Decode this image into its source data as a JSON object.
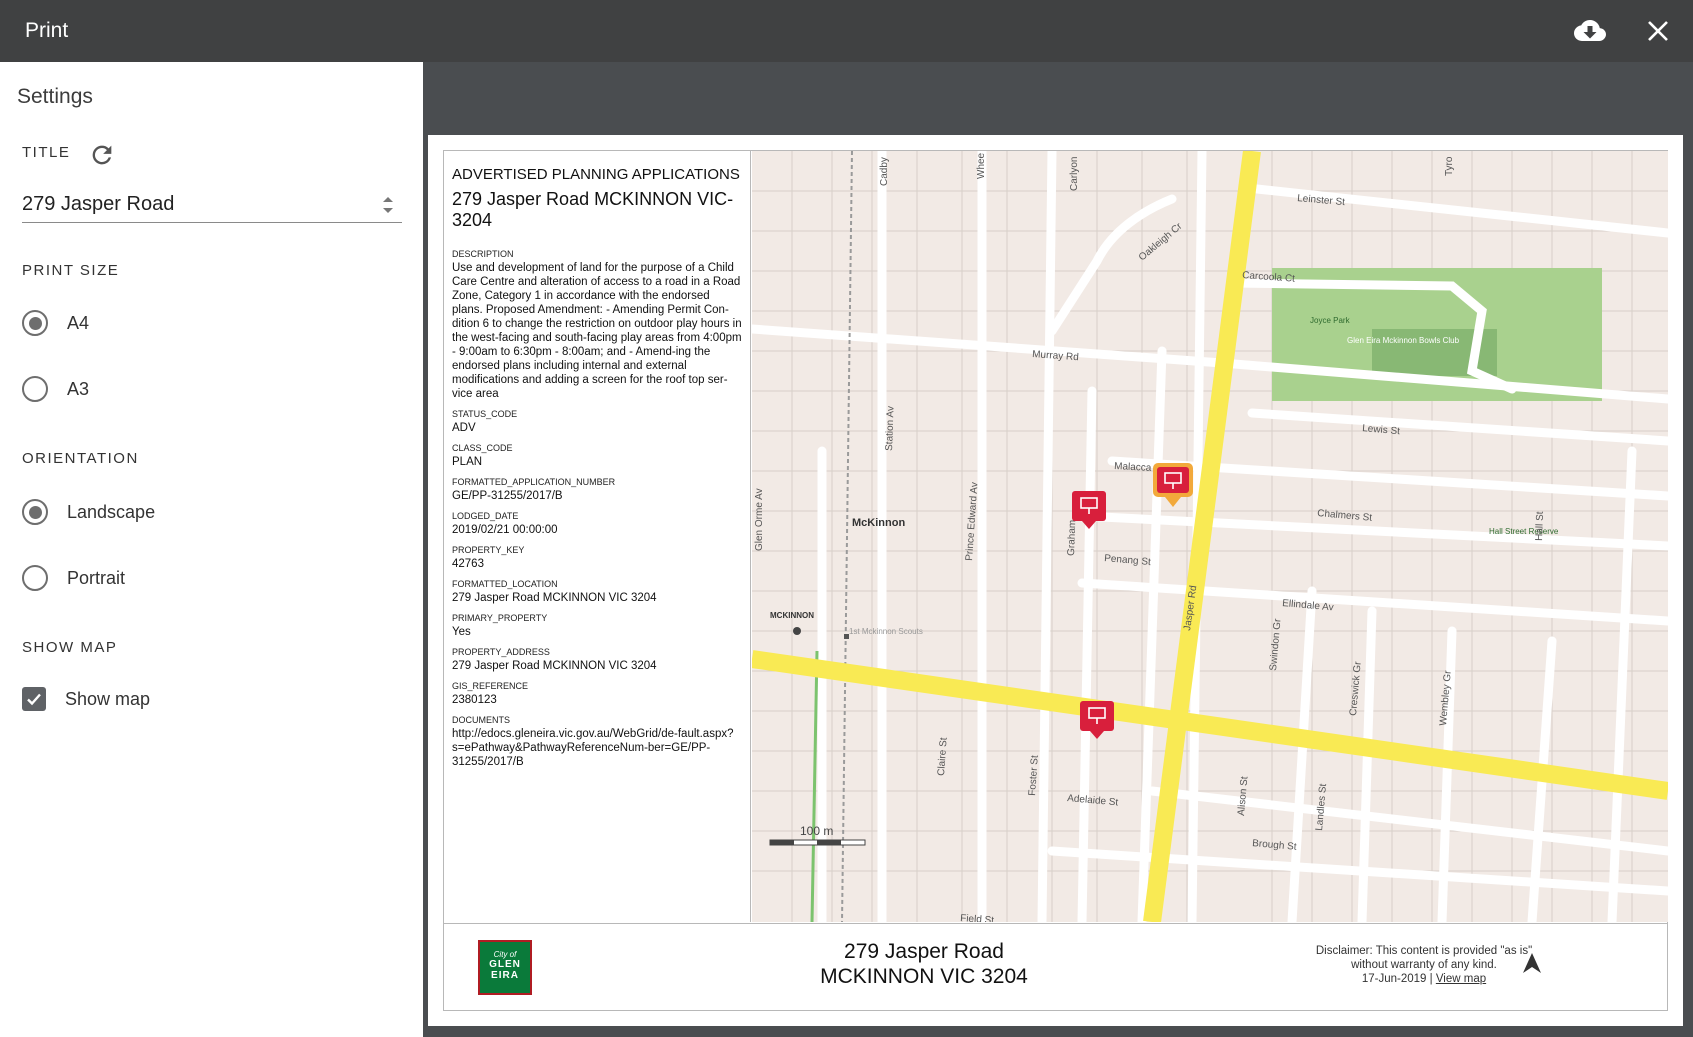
{
  "header": {
    "title": "Print",
    "download_icon": "cloud-download-icon",
    "close_icon": "close-icon"
  },
  "settings": {
    "heading": "Settings",
    "title_label": "TITLE",
    "title_value": "279 Jasper Road",
    "print_size_label": "PRINT SIZE",
    "print_sizes": [
      "A4",
      "A3"
    ],
    "print_size_selected": "A4",
    "orientation_label": "ORIENTATION",
    "orientations": [
      "Landscape",
      "Portrait"
    ],
    "orientation_selected": "Landscape",
    "show_map_label": "SHOW MAP",
    "show_map_option": "Show map",
    "show_map_checked": true
  },
  "preview": {
    "info_title": "ADVERTISED PLANNING APPLICATIONS",
    "info_address": "279 Jasper Road MCKINNON  VIC-3204",
    "fields": [
      {
        "key": "DESCRIPTION",
        "value": "Use and development of land for the purpose of a Child Care Centre and alteration of access to a road in a Road Zone, Category 1 in accordance with the endorsed plans.  Proposed Amendment: - Amending Permit Con-dition 6 to change the restriction on outdoor play hours in the west-facing and south-facing play areas from 4:00pm - 9:00am to 6:30pm - 8:00am; and - Amend-ing the endorsed plans including internal and external modifications and adding a screen for the roof top ser-vice area"
      },
      {
        "key": "STATUS_CODE",
        "value": "ADV"
      },
      {
        "key": "CLASS_CODE",
        "value": "PLAN"
      },
      {
        "key": "FORMATTED_APPLICATION_NUMBER",
        "value": "GE/PP-31255/2017/B"
      },
      {
        "key": "LODGED_DATE",
        "value": "2019/02/21 00:00:00"
      },
      {
        "key": "PROPERTY_KEY",
        "value": "42763"
      },
      {
        "key": "FORMATTED_LOCATION",
        "value": "279 Jasper Road MCKINNON  VIC  3204"
      },
      {
        "key": "PRIMARY_PROPERTY",
        "value": "Yes"
      },
      {
        "key": "PROPERTY_ADDRESS",
        "value": "279 Jasper Road MCKINNON  VIC  3204"
      },
      {
        "key": "GIS_REFERENCE",
        "value": "2380123"
      },
      {
        "key": "DOCUMENTS",
        "value": "http://edocs.gleneira.vic.gov.au/WebGrid/de-fault.aspx?s=ePathway&PathwayReferenceNum-ber=GE/PP-31255/2017/B"
      }
    ],
    "map_labels": {
      "leinster": "Leinster St",
      "oakleigh": "Oakleigh Cr",
      "carcoola": "Carcoola Ct",
      "joyce": "Joyce Park",
      "bowls": "Glen Eira Mckinnon Bowls Club",
      "murray": "Murray Rd",
      "lewis": "Lewis St",
      "malacca": "Malacca",
      "chalmers": "Chalmers St",
      "hall_reserve": "Hall Street Reserve",
      "hall": "Hall St",
      "mckinnon": "McKinnon",
      "penang": "Penang St",
      "ellindale": "Ellindale Av",
      "jasper": "Jasper Rd",
      "station": "Station Av",
      "prince_edward": "Prince Edward Av",
      "glen_orme": "Glen Orme Av",
      "graham": "Graham",
      "mckinnon_station": "MCKINNON",
      "scouts": "1st Mckinnon Scouts",
      "swindon": "Swindon Gr",
      "creswick": "Creswick Gr",
      "wembley": "Wembley Gr",
      "clairs": "Claire St",
      "foster": "Foster St",
      "adelaide": "Adelaide St",
      "alison": "Alison St",
      "landles": "Landles St",
      "brough": "Brough St",
      "cadby": "Cadby",
      "carlyon": "Carlyon",
      "wheeler": "Whee",
      "tyrone": "Tyro",
      "field": "Field St",
      "scale": "100 m"
    },
    "footer": {
      "logo_line1": "City of",
      "logo_line2": "GLEN",
      "logo_line3": "EIRA",
      "address_line1": "279 Jasper Road",
      "address_line2": "MCKINNON VIC 3204",
      "disclaimer_line1": "Disclaimer: This content is provided \"as is\"",
      "disclaimer_line2": "without warranty of any kind.",
      "date": "17-Jun-2019",
      "separator": "|",
      "view_map": "View map",
      "north_icon": "north-arrow-icon"
    }
  }
}
